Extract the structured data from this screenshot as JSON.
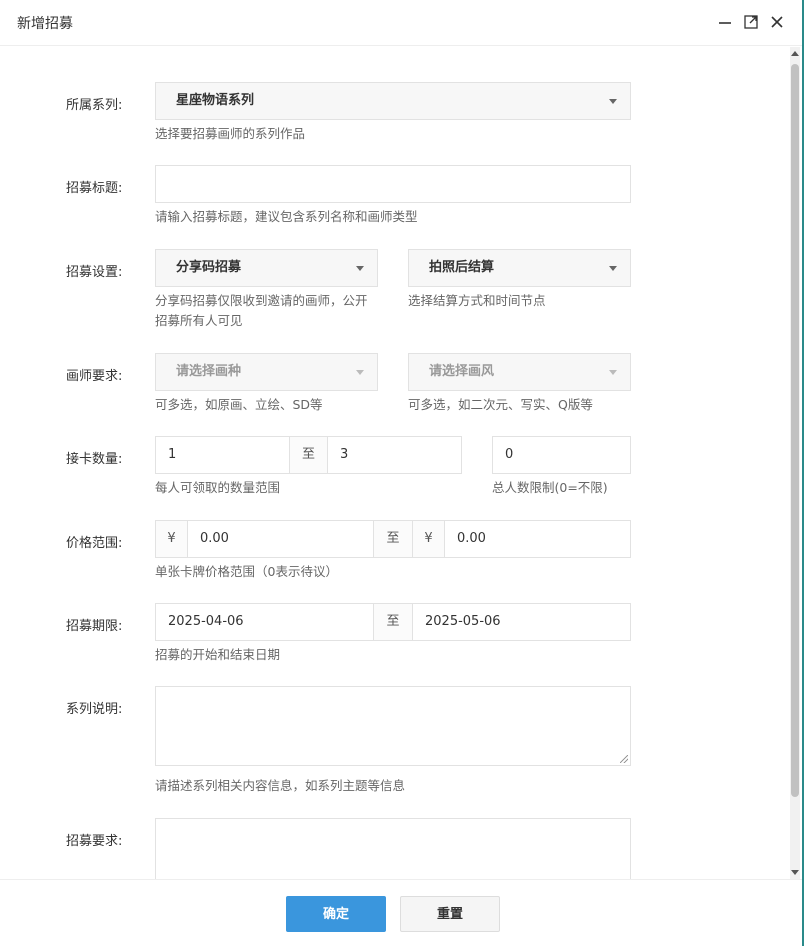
{
  "dialog": {
    "title": "新增招募",
    "window_buttons": [
      "minimize-icon",
      "maximize-icon",
      "close-icon"
    ]
  },
  "form": {
    "series": {
      "label": "所属系列:",
      "value": "星座物语系列",
      "hint": "选择要招募画师的系列作品"
    },
    "title_field": {
      "label": "招募标题:",
      "value": "",
      "hint": "请输入招募标题，建议包含系列名称和画师类型"
    },
    "settings": {
      "label": "招募设置:",
      "mode_value": "分享码招募",
      "mode_hint_line1": "分享码招募仅限收到邀请的画师，公开",
      "mode_hint_line2": "招募所有人可见",
      "settle_value": "拍照后结算",
      "settle_hint": "选择结算方式和时间节点"
    },
    "artist": {
      "label": "画师要求:",
      "type_placeholder": "请选择画种",
      "type_hint": "可多选，如原画、立绘、SD等",
      "style_placeholder": "请选择画风",
      "style_hint": "可多选，如二次元、写实、Q版等"
    },
    "cards": {
      "label": "接卡数量:",
      "min": "1",
      "to": "至",
      "max": "3",
      "hint": "每人可领取的数量范围",
      "total": "0",
      "total_hint": "总人数限制(0=不限)"
    },
    "price": {
      "label": "价格范围:",
      "currency": "¥",
      "min": "0.00",
      "to": "至",
      "max": "0.00",
      "hint": "单张卡牌价格范围（0表示待议）"
    },
    "period": {
      "label": "招募期限:",
      "start": "2025-04-06",
      "to": "至",
      "end": "2025-05-06",
      "hint": "招募的开始和结束日期"
    },
    "description": {
      "label": "系列说明:",
      "value": "",
      "hint": "请描述系列相关内容信息，如系列主题等信息"
    },
    "requirement": {
      "label": "招募要求:",
      "value": ""
    }
  },
  "footer": {
    "confirm_label": "确定",
    "reset_label": "重置"
  },
  "colors": {
    "primary": "#3a96dd",
    "border": "#e2e2e2",
    "select_bg": "#f7f7f7"
  }
}
